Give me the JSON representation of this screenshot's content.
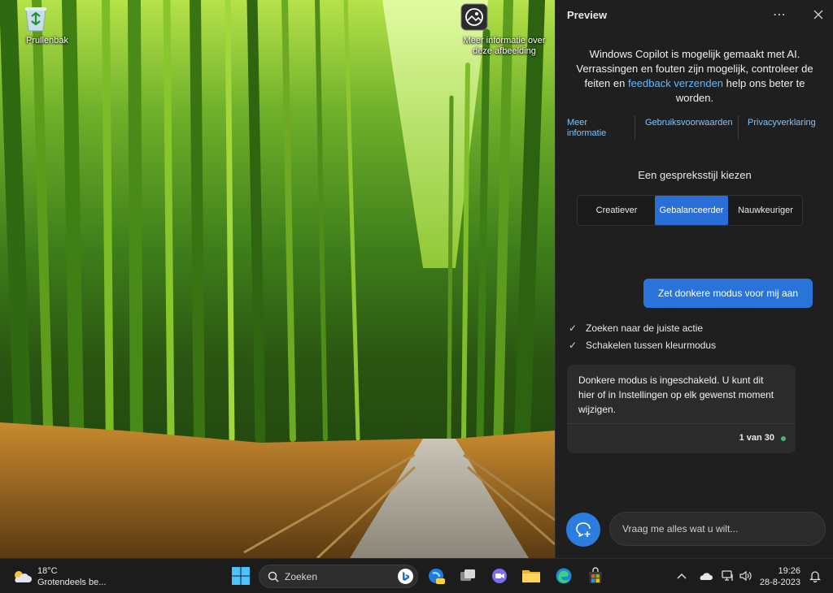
{
  "desktop": {
    "recycle_bin_label": "Prullenbak",
    "wallpaper_info_label": "Meer informatie over deze afbeelding"
  },
  "copilot": {
    "title": "Preview",
    "disclaimer_line1": "Windows Copilot is mogelijk gemaakt met AI. Verrassingen en fouten zijn mogelijk, controleer de feiten en",
    "disclaimer_link": "feedback verzenden",
    "disclaimer_line2": "help ons beter te worden.",
    "links": [
      "Meer informatie",
      "Gebruiksvoorwaarden",
      "Privacyverklaring"
    ],
    "style_label": "Een gespreksstijl kiezen",
    "styles": [
      {
        "label": "Creatiever",
        "active": false
      },
      {
        "label": "Gebalanceerder",
        "active": true
      },
      {
        "label": "Nauwkeuriger",
        "active": false
      }
    ],
    "user_message": "Zet donkere modus voor mij aan",
    "steps": [
      "Zoeken naar de juiste actie",
      "Schakelen tussen kleurmodus"
    ],
    "bot_reply": "Donkere modus is ingeschakeld. U kunt dit hier of in Instellingen op elk gewenst moment wijzigen.",
    "reply_count": "1 van 30",
    "input_placeholder": "Vraag me alles wat u wilt..."
  },
  "taskbar": {
    "weather_temp": "18°C",
    "weather_desc": "Grotendeels be...",
    "search_label": "Zoeken",
    "time": "19:26",
    "date": "28-8-2023"
  },
  "colors": {
    "accent": "#2a74d9",
    "panel_bg": "#1f1f1f",
    "taskbar_bg": "#1c1c1c",
    "link": "#5fb7ff",
    "status_dot": "#3fbf5f"
  }
}
